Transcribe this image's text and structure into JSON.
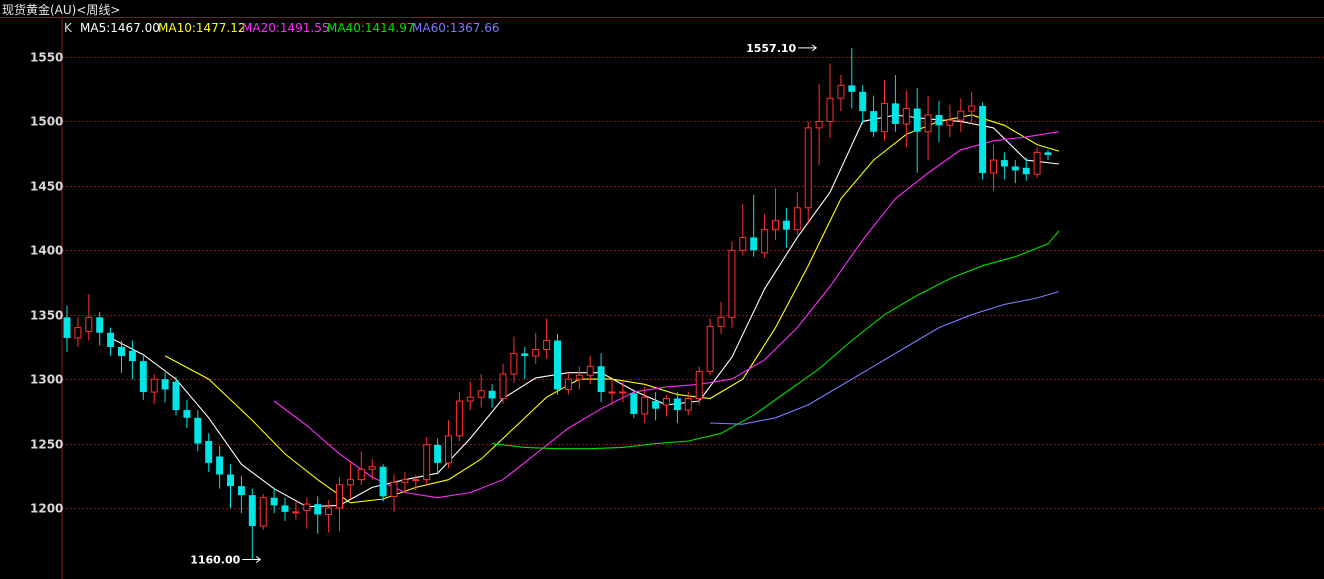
{
  "window": {
    "title": "现货黄金(AU)<周线>"
  },
  "legend": [
    {
      "key": "k",
      "label": "K",
      "color": "#d8d8d8"
    },
    {
      "key": "ma5",
      "label": "MA5:1467.00",
      "color": "#ffffff"
    },
    {
      "key": "ma10",
      "label": "MA10:1477.12",
      "color": "#ffff00"
    },
    {
      "key": "ma20",
      "label": "MA20:1491.55",
      "color": "#ff2bff"
    },
    {
      "key": "ma40",
      "label": "MA40:1414.97",
      "color": "#00e000"
    },
    {
      "key": "ma60",
      "label": "MA60:1367.66",
      "color": "#7b7bff"
    }
  ],
  "colors": {
    "up": "#ff3030",
    "down": "#00e5e5",
    "grid": "#8b1a1a",
    "axis": "#8b1a1a",
    "background": "#000000"
  },
  "chart_data": {
    "type": "candlestick",
    "title": "现货黄金(AU)<周线>",
    "ylim": [
      1150,
      1590
    ],
    "y_ticks": [
      1200,
      1250,
      1300,
      1350,
      1400,
      1450,
      1500,
      1550
    ],
    "grid": true,
    "annotations": [
      {
        "label": "1557.10",
        "value": 1557.1,
        "type": "high",
        "index": 68
      },
      {
        "label": "1160.00",
        "value": 1160.0,
        "type": "low",
        "index": 17
      }
    ],
    "candles": [
      [
        1348,
        1332,
        1357,
        1321
      ],
      [
        1332,
        1340,
        1348,
        1325
      ],
      [
        1337,
        1348,
        1366,
        1330
      ],
      [
        1348,
        1336,
        1352,
        1326
      ],
      [
        1336,
        1325,
        1340,
        1318
      ],
      [
        1325,
        1318,
        1330,
        1305
      ],
      [
        1322,
        1314,
        1330,
        1300
      ],
      [
        1314,
        1290,
        1318,
        1284
      ],
      [
        1290,
        1300,
        1304,
        1281
      ],
      [
        1300,
        1292,
        1305,
        1282
      ],
      [
        1298,
        1276,
        1302,
        1272
      ],
      [
        1276,
        1270,
        1284,
        1262
      ],
      [
        1270,
        1250,
        1276,
        1244
      ],
      [
        1252,
        1235,
        1258,
        1228
      ],
      [
        1240,
        1226,
        1248,
        1215
      ],
      [
        1226,
        1217,
        1234,
        1200
      ],
      [
        1217,
        1210,
        1225,
        1196
      ],
      [
        1210,
        1186,
        1215,
        1160
      ],
      [
        1186,
        1208,
        1211,
        1183
      ],
      [
        1208,
        1202,
        1216,
        1196
      ],
      [
        1202,
        1197,
        1208,
        1190
      ],
      [
        1197,
        1197,
        1205,
        1191
      ],
      [
        1198,
        1203,
        1208,
        1184
      ],
      [
        1203,
        1195,
        1209,
        1180
      ],
      [
        1195,
        1200,
        1206,
        1181
      ],
      [
        1200,
        1218,
        1224,
        1182
      ],
      [
        1218,
        1222,
        1236,
        1207
      ],
      [
        1222,
        1230,
        1244,
        1218
      ],
      [
        1230,
        1232,
        1238,
        1222
      ],
      [
        1232,
        1209,
        1234,
        1205
      ],
      [
        1209,
        1220,
        1226,
        1197
      ],
      [
        1220,
        1222,
        1228,
        1212
      ],
      [
        1222,
        1222,
        1226,
        1214
      ],
      [
        1222,
        1249,
        1255,
        1218
      ],
      [
        1249,
        1235,
        1254,
        1226
      ],
      [
        1235,
        1256,
        1268,
        1231
      ],
      [
        1256,
        1283,
        1290,
        1252
      ],
      [
        1283,
        1286,
        1298,
        1276
      ],
      [
        1286,
        1291,
        1304,
        1278
      ],
      [
        1291,
        1285,
        1296,
        1278
      ],
      [
        1285,
        1304,
        1312,
        1281
      ],
      [
        1304,
        1320,
        1333,
        1297
      ],
      [
        1320,
        1318,
        1325,
        1300
      ],
      [
        1318,
        1323,
        1336,
        1312
      ],
      [
        1323,
        1330,
        1347,
        1316
      ],
      [
        1330,
        1292,
        1335,
        1288
      ],
      [
        1292,
        1300,
        1305,
        1288
      ],
      [
        1300,
        1303,
        1310,
        1292
      ],
      [
        1303,
        1310,
        1318,
        1296
      ],
      [
        1310,
        1290,
        1320,
        1282
      ],
      [
        1290,
        1290,
        1300,
        1280
      ],
      [
        1290,
        1290,
        1298,
        1282
      ],
      [
        1289,
        1273,
        1292,
        1270
      ],
      [
        1273,
        1286,
        1294,
        1266
      ],
      [
        1283,
        1277,
        1290,
        1268
      ],
      [
        1280,
        1285,
        1288,
        1271
      ],
      [
        1285,
        1276,
        1290,
        1266
      ],
      [
        1276,
        1285,
        1290,
        1272
      ],
      [
        1285,
        1306,
        1310,
        1280
      ],
      [
        1306,
        1341,
        1347,
        1303
      ],
      [
        1341,
        1348,
        1360,
        1335
      ],
      [
        1348,
        1400,
        1407,
        1340
      ],
      [
        1400,
        1410,
        1436,
        1396
      ],
      [
        1410,
        1400,
        1443,
        1395
      ],
      [
        1398,
        1416,
        1428,
        1394
      ],
      [
        1416,
        1423,
        1448,
        1408
      ],
      [
        1423,
        1416,
        1433,
        1402
      ],
      [
        1416,
        1433,
        1445,
        1412
      ],
      [
        1433,
        1495,
        1500,
        1420
      ],
      [
        1495,
        1500,
        1529,
        1466
      ],
      [
        1500,
        1518,
        1545,
        1487
      ],
      [
        1518,
        1528,
        1536,
        1508
      ],
      [
        1528,
        1523,
        1557,
        1510
      ],
      [
        1523,
        1508,
        1528,
        1498
      ],
      [
        1508,
        1492,
        1520,
        1488
      ],
      [
        1492,
        1514,
        1532,
        1485
      ],
      [
        1514,
        1498,
        1536,
        1492
      ],
      [
        1498,
        1510,
        1524,
        1480
      ],
      [
        1510,
        1492,
        1526,
        1460
      ],
      [
        1492,
        1505,
        1520,
        1470
      ],
      [
        1505,
        1497,
        1516,
        1484
      ],
      [
        1497,
        1501,
        1513,
        1488
      ],
      [
        1501,
        1508,
        1518,
        1492
      ],
      [
        1508,
        1512,
        1523,
        1498
      ],
      [
        1512,
        1460,
        1515,
        1455
      ],
      [
        1460,
        1470,
        1482,
        1446
      ],
      [
        1470,
        1465,
        1476,
        1455
      ],
      [
        1465,
        1462,
        1470,
        1452
      ],
      [
        1464,
        1459,
        1472,
        1454
      ],
      [
        1459,
        1476,
        1480,
        1456
      ],
      [
        1476,
        1474,
        1478,
        1470
      ]
    ],
    "ma_lines": [
      {
        "name": "MA5",
        "color": "#ffffff",
        "points": [
          [
            4,
            1332
          ],
          [
            7,
            1319
          ],
          [
            10,
            1300
          ],
          [
            13,
            1270
          ],
          [
            16,
            1234
          ],
          [
            19,
            1215
          ],
          [
            22,
            1201
          ],
          [
            25,
            1202
          ],
          [
            28,
            1216
          ],
          [
            31,
            1222
          ],
          [
            34,
            1227
          ],
          [
            37,
            1254
          ],
          [
            40,
            1285
          ],
          [
            43,
            1301
          ],
          [
            46,
            1305
          ],
          [
            49,
            1305
          ],
          [
            52,
            1291
          ],
          [
            55,
            1280
          ],
          [
            58,
            1283
          ],
          [
            61,
            1317
          ],
          [
            64,
            1370
          ],
          [
            67,
            1410
          ],
          [
            70,
            1445
          ],
          [
            73,
            1500
          ],
          [
            76,
            1505
          ],
          [
            79,
            1502
          ],
          [
            82,
            1500
          ],
          [
            85,
            1495
          ],
          [
            88,
            1470
          ],
          [
            91,
            1467
          ]
        ]
      },
      {
        "name": "MA10",
        "color": "#ffff00",
        "points": [
          [
            9,
            1318
          ],
          [
            13,
            1300
          ],
          [
            17,
            1268
          ],
          [
            20,
            1242
          ],
          [
            23,
            1222
          ],
          [
            26,
            1204
          ],
          [
            29,
            1207
          ],
          [
            32,
            1216
          ],
          [
            35,
            1222
          ],
          [
            38,
            1238
          ],
          [
            41,
            1262
          ],
          [
            44,
            1286
          ],
          [
            47,
            1300
          ],
          [
            50,
            1300
          ],
          [
            53,
            1296
          ],
          [
            56,
            1288
          ],
          [
            59,
            1285
          ],
          [
            62,
            1300
          ],
          [
            65,
            1340
          ],
          [
            68,
            1388
          ],
          [
            71,
            1440
          ],
          [
            74,
            1470
          ],
          [
            77,
            1490
          ],
          [
            80,
            1500
          ],
          [
            83,
            1505
          ],
          [
            86,
            1497
          ],
          [
            89,
            1482
          ],
          [
            91,
            1477
          ]
        ]
      },
      {
        "name": "MA20",
        "color": "#ff2bff",
        "points": [
          [
            19,
            1283
          ],
          [
            22,
            1264
          ],
          [
            25,
            1242
          ],
          [
            28,
            1224
          ],
          [
            31,
            1212
          ],
          [
            34,
            1208
          ],
          [
            37,
            1212
          ],
          [
            40,
            1222
          ],
          [
            43,
            1242
          ],
          [
            46,
            1262
          ],
          [
            49,
            1277
          ],
          [
            52,
            1290
          ],
          [
            55,
            1294
          ],
          [
            58,
            1296
          ],
          [
            61,
            1300
          ],
          [
            64,
            1315
          ],
          [
            67,
            1340
          ],
          [
            70,
            1372
          ],
          [
            73,
            1408
          ],
          [
            76,
            1440
          ],
          [
            79,
            1460
          ],
          [
            82,
            1478
          ],
          [
            85,
            1485
          ],
          [
            88,
            1488
          ],
          [
            91,
            1492
          ]
        ]
      },
      {
        "name": "MA40",
        "color": "#00e000",
        "points": [
          [
            39,
            1250
          ],
          [
            42,
            1247
          ],
          [
            45,
            1246
          ],
          [
            48,
            1246
          ],
          [
            51,
            1247
          ],
          [
            54,
            1250
          ],
          [
            57,
            1252
          ],
          [
            60,
            1258
          ],
          [
            63,
            1272
          ],
          [
            66,
            1290
          ],
          [
            69,
            1308
          ],
          [
            72,
            1330
          ],
          [
            75,
            1350
          ],
          [
            78,
            1365
          ],
          [
            81,
            1378
          ],
          [
            84,
            1388
          ],
          [
            87,
            1395
          ],
          [
            90,
            1405
          ],
          [
            91,
            1415
          ]
        ]
      },
      {
        "name": "MA60",
        "color": "#7b7bff",
        "points": [
          [
            59,
            1266
          ],
          [
            62,
            1265
          ],
          [
            65,
            1270
          ],
          [
            68,
            1280
          ],
          [
            71,
            1295
          ],
          [
            74,
            1310
          ],
          [
            77,
            1325
          ],
          [
            80,
            1340
          ],
          [
            83,
            1350
          ],
          [
            86,
            1358
          ],
          [
            89,
            1363
          ],
          [
            91,
            1368
          ]
        ]
      }
    ]
  }
}
